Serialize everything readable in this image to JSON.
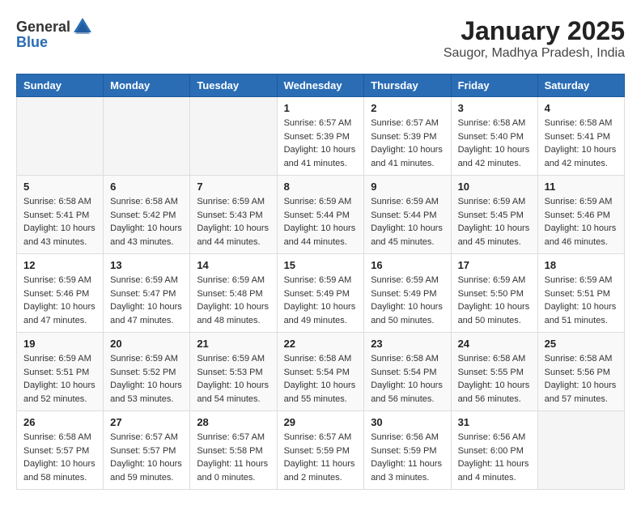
{
  "header": {
    "logo_general": "General",
    "logo_blue": "Blue",
    "month": "January 2025",
    "location": "Saugor, Madhya Pradesh, India"
  },
  "weekdays": [
    "Sunday",
    "Monday",
    "Tuesday",
    "Wednesday",
    "Thursday",
    "Friday",
    "Saturday"
  ],
  "weeks": [
    [
      {
        "day": "",
        "info": ""
      },
      {
        "day": "",
        "info": ""
      },
      {
        "day": "",
        "info": ""
      },
      {
        "day": "1",
        "info": "Sunrise: 6:57 AM\nSunset: 5:39 PM\nDaylight: 10 hours\nand 41 minutes."
      },
      {
        "day": "2",
        "info": "Sunrise: 6:57 AM\nSunset: 5:39 PM\nDaylight: 10 hours\nand 41 minutes."
      },
      {
        "day": "3",
        "info": "Sunrise: 6:58 AM\nSunset: 5:40 PM\nDaylight: 10 hours\nand 42 minutes."
      },
      {
        "day": "4",
        "info": "Sunrise: 6:58 AM\nSunset: 5:41 PM\nDaylight: 10 hours\nand 42 minutes."
      }
    ],
    [
      {
        "day": "5",
        "info": "Sunrise: 6:58 AM\nSunset: 5:41 PM\nDaylight: 10 hours\nand 43 minutes."
      },
      {
        "day": "6",
        "info": "Sunrise: 6:58 AM\nSunset: 5:42 PM\nDaylight: 10 hours\nand 43 minutes."
      },
      {
        "day": "7",
        "info": "Sunrise: 6:59 AM\nSunset: 5:43 PM\nDaylight: 10 hours\nand 44 minutes."
      },
      {
        "day": "8",
        "info": "Sunrise: 6:59 AM\nSunset: 5:44 PM\nDaylight: 10 hours\nand 44 minutes."
      },
      {
        "day": "9",
        "info": "Sunrise: 6:59 AM\nSunset: 5:44 PM\nDaylight: 10 hours\nand 45 minutes."
      },
      {
        "day": "10",
        "info": "Sunrise: 6:59 AM\nSunset: 5:45 PM\nDaylight: 10 hours\nand 45 minutes."
      },
      {
        "day": "11",
        "info": "Sunrise: 6:59 AM\nSunset: 5:46 PM\nDaylight: 10 hours\nand 46 minutes."
      }
    ],
    [
      {
        "day": "12",
        "info": "Sunrise: 6:59 AM\nSunset: 5:46 PM\nDaylight: 10 hours\nand 47 minutes."
      },
      {
        "day": "13",
        "info": "Sunrise: 6:59 AM\nSunset: 5:47 PM\nDaylight: 10 hours\nand 47 minutes."
      },
      {
        "day": "14",
        "info": "Sunrise: 6:59 AM\nSunset: 5:48 PM\nDaylight: 10 hours\nand 48 minutes."
      },
      {
        "day": "15",
        "info": "Sunrise: 6:59 AM\nSunset: 5:49 PM\nDaylight: 10 hours\nand 49 minutes."
      },
      {
        "day": "16",
        "info": "Sunrise: 6:59 AM\nSunset: 5:49 PM\nDaylight: 10 hours\nand 50 minutes."
      },
      {
        "day": "17",
        "info": "Sunrise: 6:59 AM\nSunset: 5:50 PM\nDaylight: 10 hours\nand 50 minutes."
      },
      {
        "day": "18",
        "info": "Sunrise: 6:59 AM\nSunset: 5:51 PM\nDaylight: 10 hours\nand 51 minutes."
      }
    ],
    [
      {
        "day": "19",
        "info": "Sunrise: 6:59 AM\nSunset: 5:51 PM\nDaylight: 10 hours\nand 52 minutes."
      },
      {
        "day": "20",
        "info": "Sunrise: 6:59 AM\nSunset: 5:52 PM\nDaylight: 10 hours\nand 53 minutes."
      },
      {
        "day": "21",
        "info": "Sunrise: 6:59 AM\nSunset: 5:53 PM\nDaylight: 10 hours\nand 54 minutes."
      },
      {
        "day": "22",
        "info": "Sunrise: 6:58 AM\nSunset: 5:54 PM\nDaylight: 10 hours\nand 55 minutes."
      },
      {
        "day": "23",
        "info": "Sunrise: 6:58 AM\nSunset: 5:54 PM\nDaylight: 10 hours\nand 56 minutes."
      },
      {
        "day": "24",
        "info": "Sunrise: 6:58 AM\nSunset: 5:55 PM\nDaylight: 10 hours\nand 56 minutes."
      },
      {
        "day": "25",
        "info": "Sunrise: 6:58 AM\nSunset: 5:56 PM\nDaylight: 10 hours\nand 57 minutes."
      }
    ],
    [
      {
        "day": "26",
        "info": "Sunrise: 6:58 AM\nSunset: 5:57 PM\nDaylight: 10 hours\nand 58 minutes."
      },
      {
        "day": "27",
        "info": "Sunrise: 6:57 AM\nSunset: 5:57 PM\nDaylight: 10 hours\nand 59 minutes."
      },
      {
        "day": "28",
        "info": "Sunrise: 6:57 AM\nSunset: 5:58 PM\nDaylight: 11 hours\nand 0 minutes."
      },
      {
        "day": "29",
        "info": "Sunrise: 6:57 AM\nSunset: 5:59 PM\nDaylight: 11 hours\nand 2 minutes."
      },
      {
        "day": "30",
        "info": "Sunrise: 6:56 AM\nSunset: 5:59 PM\nDaylight: 11 hours\nand 3 minutes."
      },
      {
        "day": "31",
        "info": "Sunrise: 6:56 AM\nSunset: 6:00 PM\nDaylight: 11 hours\nand 4 minutes."
      },
      {
        "day": "",
        "info": ""
      }
    ]
  ]
}
